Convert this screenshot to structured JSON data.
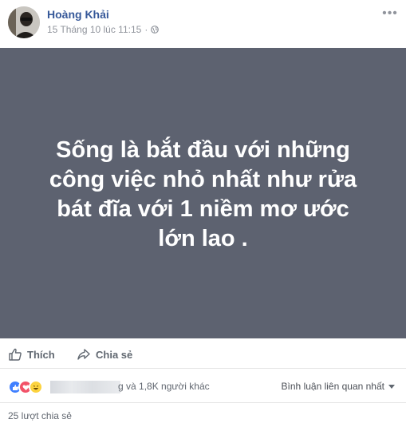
{
  "post": {
    "author": "Hoàng Khải",
    "timestamp": "15 Tháng 10 lúc 11:15",
    "text": "Sống là bắt đầu với những công việc nhỏ nhất như rửa bát đĩa với 1 niềm mơ ước lớn lao .",
    "background_color": "#5d6270"
  },
  "actions": {
    "like_label": "Thích",
    "share_label": "Chia sẻ"
  },
  "reactions": {
    "icons": [
      "like-icon",
      "love-icon",
      "haha-icon"
    ],
    "text": "g và 1,8K người khác",
    "sort_label": "Bình luận liên quan nhất"
  },
  "shares": {
    "count_text": "25 lượt chia sẻ"
  },
  "colors": {
    "link_blue": "#365899",
    "meta_gray": "#90949c",
    "like_blue": "#4080ff",
    "love_red": "#f25268",
    "haha_yellow": "#fcd33f"
  }
}
